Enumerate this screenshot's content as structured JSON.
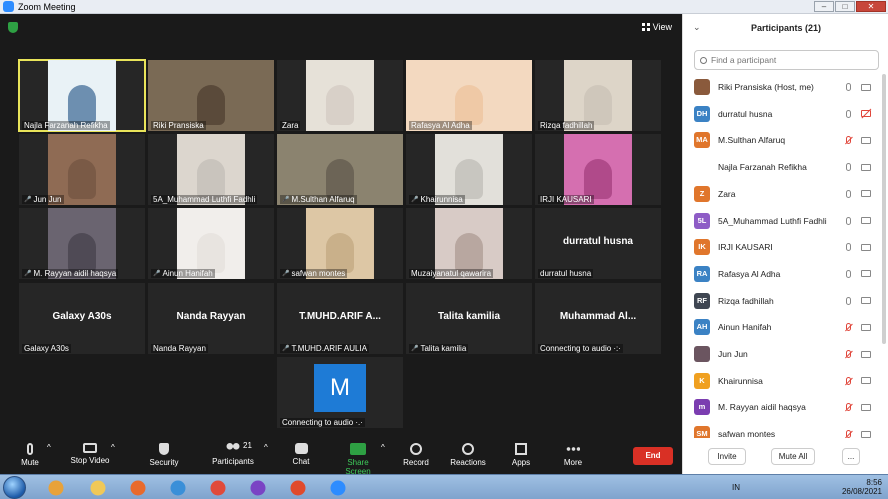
{
  "window": {
    "title": "Zoom Meeting",
    "minimize": "–",
    "maximize": "□",
    "close": "✕"
  },
  "view": {
    "label": "View",
    "icon": "grid-icon"
  },
  "tiles": [
    {
      "name": "Najla Farzanah Refikha",
      "muted": false,
      "active": true,
      "bg": "#6d8fb0",
      "thumb": "#e9f2f6"
    },
    {
      "name": "Riki Pransiska",
      "muted": false,
      "bg": "#5a4a3a",
      "thumb": "#7a6a55",
      "wide": true
    },
    {
      "name": "Zara",
      "muted": false,
      "bg": "#d8d0c8",
      "thumb": "#e6e1d8"
    },
    {
      "name": "Rafasya Al Adha",
      "muted": false,
      "bg": "#efc9a6",
      "thumb": "#f3d9c0",
      "wide": true
    },
    {
      "name": "Rizqa fadhillah",
      "muted": false,
      "bg": "#cfc7bb",
      "thumb": "#ddd5c8"
    },
    {
      "name": "Jun Jun",
      "muted": true,
      "bg": "#7a5a46",
      "thumb": "#8f6b54"
    },
    {
      "name": "5A_Muhammad Luthfi Fadhli",
      "muted": false,
      "bg": "#c9c4bd",
      "thumb": "#dcd6ce"
    },
    {
      "name": "M.Sulthan Alfaruq",
      "muted": true,
      "bg": "#6c6456",
      "thumb": "#8b836f",
      "wide": true
    },
    {
      "name": "Khairunnisa",
      "muted": true,
      "bg": "#c8c6c0",
      "thumb": "#e2e0da"
    },
    {
      "name": "IRJI KAUSARI",
      "muted": false,
      "bg": "#b04a8a",
      "thumb": "#d56fb0"
    },
    {
      "name": "M. Rayyan aidil haqsya",
      "muted": true,
      "bg": "#4f4a55",
      "thumb": "#6a6470"
    },
    {
      "name": "Ainun Hanifah",
      "muted": true,
      "bg": "#e8e4e0",
      "thumb": "#f1eeeb"
    },
    {
      "name": "safwan montes",
      "muted": true,
      "bg": "#c9b08a",
      "thumb": "#ddc7a5"
    },
    {
      "name": "Muzaiyanatul qawarira",
      "muted": false,
      "bg": "#b8a7a0",
      "thumb": "#d8cbc6"
    },
    {
      "name": "durratul husna",
      "muted": false,
      "label": "durratul husna"
    },
    {
      "name": "Galaxy A30s",
      "muted": false,
      "label": "Galaxy A30s"
    },
    {
      "name": "Nanda Rayyan",
      "muted": false,
      "label": "Nanda Rayyan"
    },
    {
      "name": "T.MUHD.ARIF AULIA",
      "muted": true,
      "label": "T.MUHD.ARIF  A..."
    },
    {
      "name": "Talita kamilia",
      "muted": true,
      "label": "Talita kamilia"
    },
    {
      "name": "Connecting to audio ·:·",
      "muted": false,
      "label": "Muhammad  Al..."
    },
    {
      "name": "Connecting to audio ·.·",
      "muted": false,
      "mbox": "M"
    }
  ],
  "toolbar": {
    "mute": "Mute",
    "stop_video": "Stop Video",
    "security": "Security",
    "participants": "Participants",
    "participants_count": "21",
    "chat": "Chat",
    "share": "Share Screen",
    "record": "Record",
    "reactions": "Reactions",
    "apps": "Apps",
    "more": "More",
    "end": "End",
    "caret": "^"
  },
  "panel": {
    "title": "Participants (21)",
    "collapse": "⌄",
    "search_placeholder": "Find a participant",
    "invite": "Invite",
    "mute_all": "Mute All",
    "more": "...",
    "participants": [
      {
        "name": "Riki Pransiska (Host, me)",
        "initials": "",
        "color": "#8a5a3c",
        "mic_muted": false,
        "cam_off": false
      },
      {
        "name": "durratul husna",
        "initials": "DH",
        "color": "#3b82c4",
        "mic_muted": false,
        "cam_off": true
      },
      {
        "name": "M.Sulthan Alfaruq",
        "initials": "MA",
        "color": "#e0762c",
        "mic_muted": true,
        "cam_off": false
      },
      {
        "name": "Najla Farzanah Refikha",
        "initials": "",
        "color": "#ffffff",
        "mic_muted": false,
        "cam_off": false
      },
      {
        "name": "Zara",
        "initials": "Z",
        "color": "#e0762c",
        "mic_muted": false,
        "cam_off": false
      },
      {
        "name": "5A_Muhammad Luthfi Fadhli",
        "initials": "5L",
        "color": "#8e5cc6",
        "mic_muted": false,
        "cam_off": false
      },
      {
        "name": "IRJI KAUSARI",
        "initials": "IK",
        "color": "#e0762c",
        "mic_muted": false,
        "cam_off": false
      },
      {
        "name": "Rafasya Al Adha",
        "initials": "RA",
        "color": "#3b82c4",
        "mic_muted": false,
        "cam_off": false
      },
      {
        "name": "Rizqa fadhillah",
        "initials": "RF",
        "color": "#3f4652",
        "mic_muted": false,
        "cam_off": false
      },
      {
        "name": "Ainun Hanifah",
        "initials": "AH",
        "color": "#3b82c4",
        "mic_muted": true,
        "cam_off": false
      },
      {
        "name": "Jun Jun",
        "initials": "",
        "color": "#6b5560",
        "mic_muted": true,
        "cam_off": false
      },
      {
        "name": "Khairunnisa",
        "initials": "K",
        "color": "#f0a020",
        "mic_muted": true,
        "cam_off": false
      },
      {
        "name": "M. Rayyan aidil haqsya",
        "initials": "m",
        "color": "#7b3db0",
        "mic_muted": true,
        "cam_off": false
      },
      {
        "name": "safwan montes",
        "initials": "SM",
        "color": "#e0762c",
        "mic_muted": true,
        "cam_off": false
      }
    ]
  },
  "taskbar": {
    "lang": "IN",
    "time": "8:56",
    "date": "26/08/2021",
    "apps": [
      {
        "icon": "media-player-icon",
        "color": "#e8a23a"
      },
      {
        "icon": "explorer-icon",
        "color": "#f0c858"
      },
      {
        "icon": "firefox-icon",
        "color": "#e86a2c"
      },
      {
        "icon": "internet-explorer-icon",
        "color": "#3a8fd8"
      },
      {
        "icon": "chrome-icon",
        "color": "#e04a3a"
      },
      {
        "icon": "media-icon",
        "color": "#7a44c4"
      },
      {
        "icon": "wps-icon",
        "color": "#e04a2c"
      },
      {
        "icon": "zoom-icon",
        "color": "#2d8cff"
      }
    ]
  }
}
